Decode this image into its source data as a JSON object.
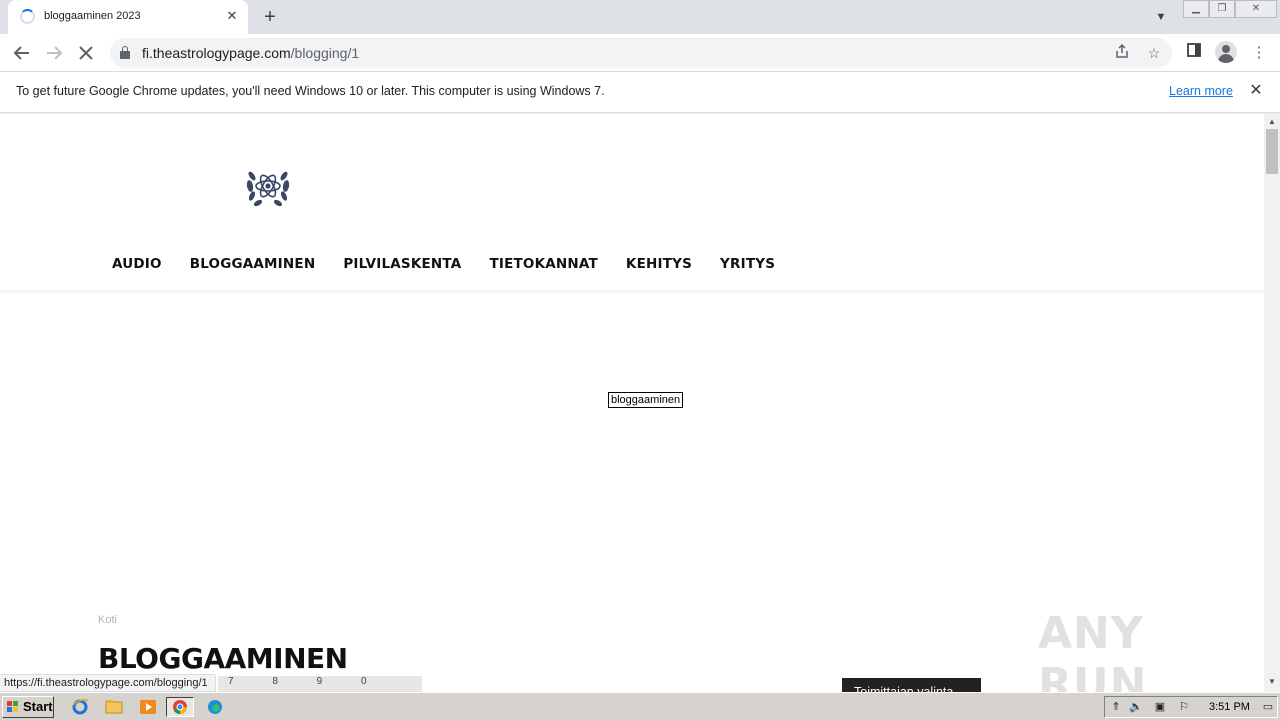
{
  "browser": {
    "tab_title": "bloggaaminen 2023",
    "url_host": "fi.theastrologypage.com",
    "url_path": "/blogging/1",
    "infobar_message": "To get future Google Chrome updates, you'll need Windows 10 or later. This computer is using Windows 7.",
    "infobar_link": "Learn more",
    "status_url": "https://fi.theastrologypage.com/blogging/1"
  },
  "site": {
    "nav": [
      "AUDIO",
      "BLOGGAAMINEN",
      "PILVILASKENTA",
      "TIETOKANNAT",
      "KEHITYS",
      "YRITYS"
    ],
    "image_alt": "bloggaaminen",
    "breadcrumb": "Koti",
    "page_title": "BLOGGAAMINEN",
    "thumbnail_keys": "7 8 9 0",
    "editor_badge": "Toimittajan valinta"
  },
  "watermark": "ANY RUN",
  "taskbar": {
    "start_label": "Start",
    "clock": "3:51 PM"
  },
  "colors": {
    "accent_blue": "#1a73e8",
    "logo_navy": "#3b4566",
    "taskbar": "#d6d3ce"
  }
}
